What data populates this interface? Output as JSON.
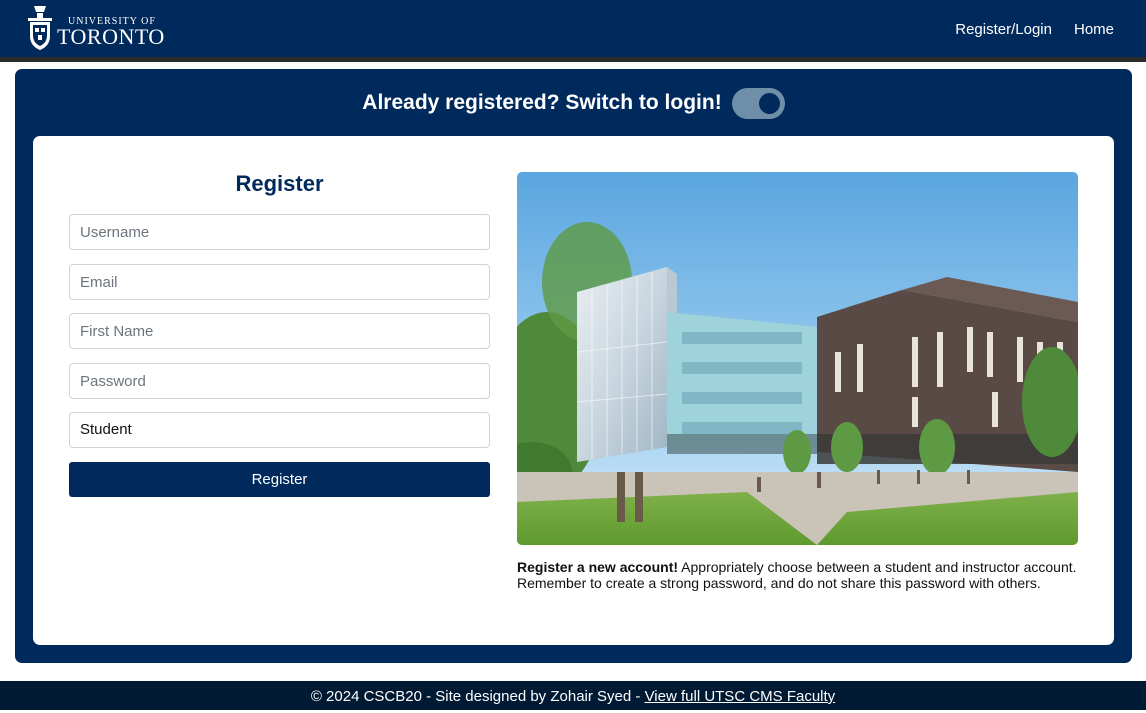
{
  "header": {
    "logo_line1": "UNIVERSITY OF",
    "logo_line2": "TORONTO",
    "nav": [
      {
        "label": "Register/Login"
      },
      {
        "label": "Home"
      }
    ]
  },
  "switch": {
    "text": "Already registered? Switch to login!",
    "state": "on"
  },
  "form": {
    "title": "Register",
    "username_placeholder": "Username",
    "email_placeholder": "Email",
    "firstname_placeholder": "First Name",
    "password_placeholder": "Password",
    "role_value": "Student",
    "submit_label": "Register"
  },
  "info": {
    "caption_bold": "Register a new account!",
    "caption_text": " Appropriately choose between a student and instructor account. Remember to create a strong password, and do not share this password with others."
  },
  "footer": {
    "text": "© 2024 CSCB20 - Site designed by Zohair Syed - ",
    "link": "View full UTSC CMS Faculty"
  },
  "colors": {
    "brand_navy": "#002a5c",
    "footer_bg": "#001a33",
    "toggle_track": "#6f8fa8"
  }
}
